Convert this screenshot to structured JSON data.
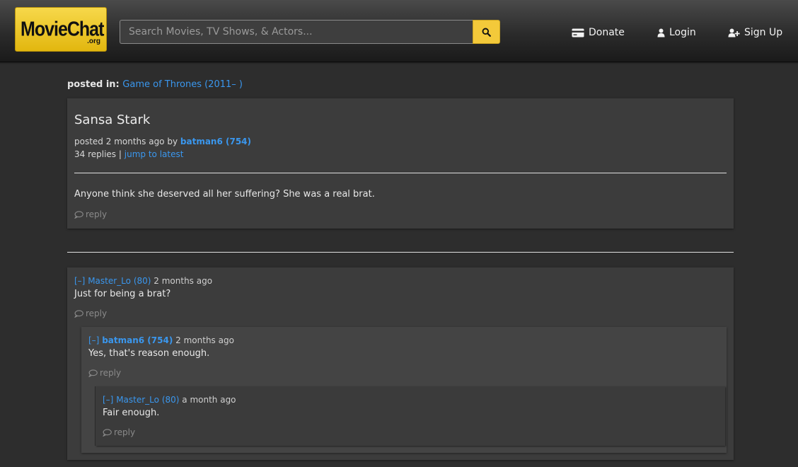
{
  "header": {
    "logo_main": "MovieChat",
    "logo_sub": ".org",
    "search_placeholder": "Search Movies, TV Shows, & Actors...",
    "nav": {
      "donate": "Donate",
      "login": "Login",
      "signup": "Sign Up"
    },
    "accent_color": "#f3c93a"
  },
  "breadcrumb": {
    "prefix": "posted in:",
    "board": "Game of Thrones (2011– )"
  },
  "topic": {
    "title": "Sansa Stark",
    "posted_prefix": "posted",
    "posted_time": "2 months ago",
    "by": "by",
    "author": "batman6 (754)",
    "replies": "34 replies",
    "separator": "|",
    "jump": "jump to latest",
    "body": "Anyone think she deserved all her suffering? She was a real brat.",
    "reply": "reply"
  },
  "comments": [
    {
      "collapse": "[–]",
      "user": "Master_Lo (80)",
      "time": "2 months ago",
      "body": "Just for being a brat?",
      "reply": "reply"
    },
    {
      "collapse": "[–]",
      "user": "batman6 (754)",
      "time": "2 months ago",
      "body": "Yes, that's reason enough.",
      "reply": "reply"
    },
    {
      "collapse": "[–]",
      "user": "Master_Lo (80)",
      "time": "a month ago",
      "body": "Fair enough.",
      "reply": "reply"
    }
  ],
  "icons": {
    "search": "search-icon",
    "donate": "credit-card-icon",
    "login": "user-icon",
    "signup": "user-plus-icon",
    "reply": "comment-icon"
  }
}
